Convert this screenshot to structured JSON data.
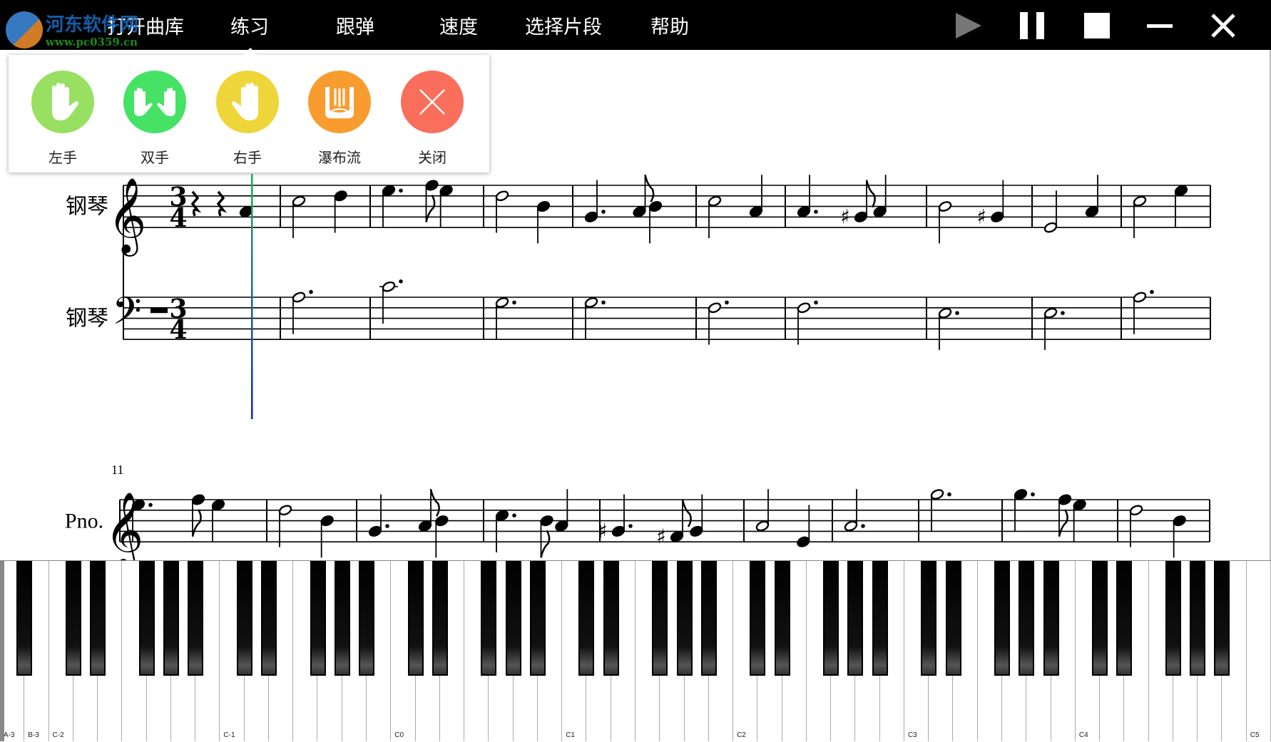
{
  "watermark": {
    "title": "河东软件网",
    "url": "www.pc0359.cn"
  },
  "menu": [
    {
      "label": "打开曲库"
    },
    {
      "label": "练习"
    },
    {
      "label": "跟弹"
    },
    {
      "label": "速度"
    },
    {
      "label": "选择片段"
    },
    {
      "label": "帮助"
    }
  ],
  "controls": [
    {
      "icon": "play-icon",
      "state": "disabled"
    },
    {
      "icon": "pause-icon"
    },
    {
      "icon": "stop-icon"
    },
    {
      "icon": "minimize-icon"
    },
    {
      "icon": "close-icon"
    }
  ],
  "practice_popup": {
    "items": [
      {
        "label": "左手",
        "icon": "left-hand-icon",
        "color": "#97e061"
      },
      {
        "label": "双手",
        "icon": "both-hands-icon",
        "color": "#45e265"
      },
      {
        "label": "右手",
        "icon": "right-hand-icon",
        "color": "#eed63a"
      },
      {
        "label": "瀑布流",
        "icon": "waterfall-icon",
        "color": "#f99c30"
      },
      {
        "label": "关闭",
        "icon": "close-icon",
        "color": "#f96f5c"
      }
    ]
  },
  "score": {
    "time_signature": "3/4",
    "systems": [
      {
        "measure_number": "",
        "staves": [
          {
            "label": "钢琴",
            "clef": "treble",
            "measures": [
              [
                {
                  "d": "r"
                },
                {
                  "d": "r"
                },
                {
                  "p": "A4",
                  "d": "q"
                }
              ],
              [
                {
                  "p": "C5",
                  "d": "h"
                },
                {
                  "p": "D5",
                  "d": "q"
                }
              ],
              [
                {
                  "p": "E5",
                  "d": "qd"
                },
                {
                  "p": "F5",
                  "d": "e"
                },
                {
                  "p": "E5",
                  "d": "q"
                }
              ],
              [
                {
                  "p": "D5",
                  "d": "h"
                },
                {
                  "p": "B4",
                  "d": "q"
                }
              ],
              [
                {
                  "p": "G4",
                  "d": "qd"
                },
                {
                  "p": "A4",
                  "d": "e"
                },
                {
                  "p": "B4",
                  "d": "q"
                }
              ],
              [
                {
                  "p": "C5",
                  "d": "h"
                },
                {
                  "p": "A4",
                  "d": "q"
                }
              ],
              [
                {
                  "p": "A4",
                  "d": "qd"
                },
                {
                  "p": "G#4",
                  "d": "e"
                },
                {
                  "p": "A4",
                  "d": "q"
                }
              ],
              [
                {
                  "p": "B4",
                  "d": "h"
                },
                {
                  "p": "G#4",
                  "d": "q"
                }
              ],
              [
                {
                  "p": "E4",
                  "d": "h"
                },
                {
                  "p": "A4",
                  "d": "q"
                }
              ],
              [
                {
                  "p": "C5",
                  "d": "h"
                },
                {
                  "p": "E5",
                  "d": "q"
                }
              ]
            ]
          },
          {
            "label": "钢琴",
            "clef": "bass",
            "measures": [
              [
                {
                  "d": "mr"
                }
              ],
              [
                {
                  "p": "A3",
                  "d": "hd"
                }
              ],
              [
                {
                  "p": "C4",
                  "d": "hd"
                }
              ],
              [
                {
                  "p": "G3",
                  "d": "hd"
                }
              ],
              [
                {
                  "p": "G3",
                  "d": "hd"
                }
              ],
              [
                {
                  "p": "F3",
                  "d": "hd"
                }
              ],
              [
                {
                  "p": "F3",
                  "d": "hd"
                }
              ],
              [
                {
                  "p": "E3",
                  "d": "hd"
                }
              ],
              [
                {
                  "p": "E3",
                  "d": "hd"
                }
              ],
              [
                {
                  "p": "A3",
                  "d": "hd"
                }
              ]
            ]
          }
        ]
      },
      {
        "measure_number": "11",
        "staves": [
          {
            "label": "Pno.",
            "clef": "treble",
            "measures": [
              [
                {
                  "p": "E5",
                  "d": "qd"
                },
                {
                  "p": "F5",
                  "d": "e"
                },
                {
                  "p": "E5",
                  "d": "q"
                }
              ],
              [
                {
                  "p": "D5",
                  "d": "h"
                },
                {
                  "p": "B4",
                  "d": "q"
                }
              ],
              [
                {
                  "p": "G4",
                  "d": "qd"
                },
                {
                  "p": "A4",
                  "d": "e"
                },
                {
                  "p": "B4",
                  "d": "q"
                }
              ],
              [
                {
                  "p": "C5",
                  "d": "qd"
                },
                {
                  "p": "B4",
                  "d": "e"
                },
                {
                  "p": "A4",
                  "d": "q"
                }
              ],
              [
                {
                  "p": "G#4",
                  "d": "qd"
                },
                {
                  "p": "F#4",
                  "d": "e"
                },
                {
                  "p": "G4",
                  "d": "q"
                }
              ],
              [
                {
                  "p": "A4",
                  "d": "h"
                },
                {
                  "p": "E4",
                  "d": "q"
                }
              ],
              [
                {
                  "p": "A4",
                  "d": "hd"
                }
              ],
              [
                {
                  "p": "G5",
                  "d": "hd"
                }
              ],
              [
                {
                  "p": "G5",
                  "d": "qd"
                },
                {
                  "p": "F5",
                  "d": "e"
                },
                {
                  "p": "E5",
                  "d": "q"
                }
              ],
              [
                {
                  "p": "D5",
                  "d": "h"
                },
                {
                  "p": "B4",
                  "d": "q"
                }
              ]
            ]
          }
        ]
      }
    ]
  },
  "playback_cursor": {
    "measure": 1,
    "beat": 3
  },
  "piano": {
    "white_keys": 52,
    "labels": [
      {
        "key": 0,
        "text": "A-3"
      },
      {
        "key": 1,
        "text": "B-3"
      },
      {
        "key": 2,
        "text": "C-2"
      },
      {
        "key": 9,
        "text": "C-1"
      },
      {
        "key": 16,
        "text": "C0"
      },
      {
        "key": 23,
        "text": "C1"
      },
      {
        "key": 30,
        "text": "C2"
      },
      {
        "key": 37,
        "text": "C3"
      },
      {
        "key": 44,
        "text": "C4"
      },
      {
        "key": 51,
        "text": "C5"
      }
    ]
  }
}
